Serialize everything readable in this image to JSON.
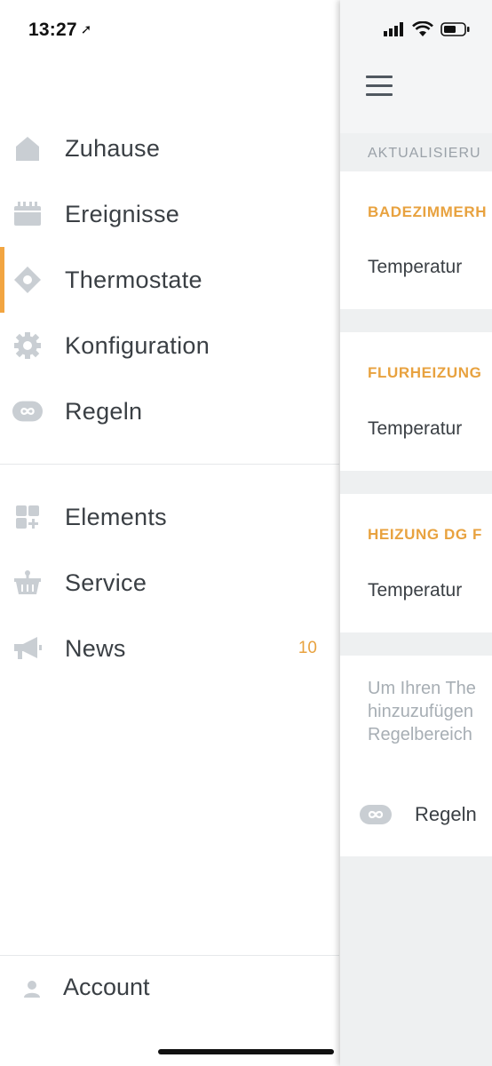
{
  "status_bar": {
    "time": "13:27"
  },
  "drawer": {
    "items_primary": [
      {
        "label": "Zuhause",
        "icon": "home-icon"
      },
      {
        "label": "Ereignisse",
        "icon": "calendar-icon"
      },
      {
        "label": "Thermostate",
        "icon": "thermostat-icon",
        "active": true
      },
      {
        "label": "Konfiguration",
        "icon": "gear-icon"
      },
      {
        "label": "Regeln",
        "icon": "infinity-icon"
      }
    ],
    "items_secondary": [
      {
        "label": "Elements",
        "icon": "elements-grid-icon"
      },
      {
        "label": "Service",
        "icon": "basket-icon"
      },
      {
        "label": "News",
        "icon": "megaphone-icon",
        "badge": "10"
      }
    ],
    "account": {
      "label": "Account",
      "icon": "person-icon"
    }
  },
  "main": {
    "section_label": "AKTUALISIERU",
    "cards": [
      {
        "title": "BADEZIMMERH",
        "row_label": "Temperatur"
      },
      {
        "title": "FLURHEIZUNG",
        "row_label": "Temperatur"
      },
      {
        "title": "HEIZUNG DG F",
        "row_label": "Temperatur"
      }
    ],
    "info_lines": [
      "Um Ihren The",
      "hinzuzufügen",
      "Regelbereich"
    ],
    "rules_link": {
      "label": "Regeln",
      "icon": "infinity-icon"
    }
  },
  "colors": {
    "accent": "#f2a541",
    "icon_gray": "#c9ced3",
    "text_dark": "#3a3f44",
    "muted": "#a7aeb4",
    "background": "#eef0f1"
  }
}
